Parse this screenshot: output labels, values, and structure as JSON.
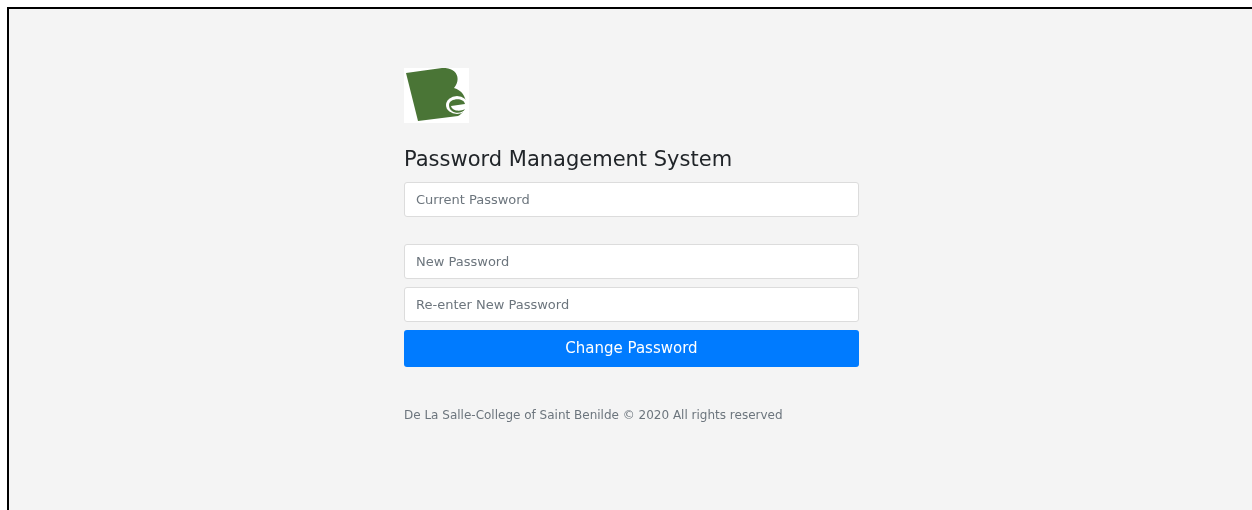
{
  "title": "Password Management System",
  "current_password_field": {
    "placeholder": "Current Password"
  },
  "new_password_fields": [
    {
      "placeholder": "New Password"
    },
    {
      "placeholder": "Re-enter New Password"
    }
  ],
  "submit_button": {
    "label": "Change Password"
  },
  "footer": "De La Salle-College of Saint Benilde © 2020 All rights reserved"
}
